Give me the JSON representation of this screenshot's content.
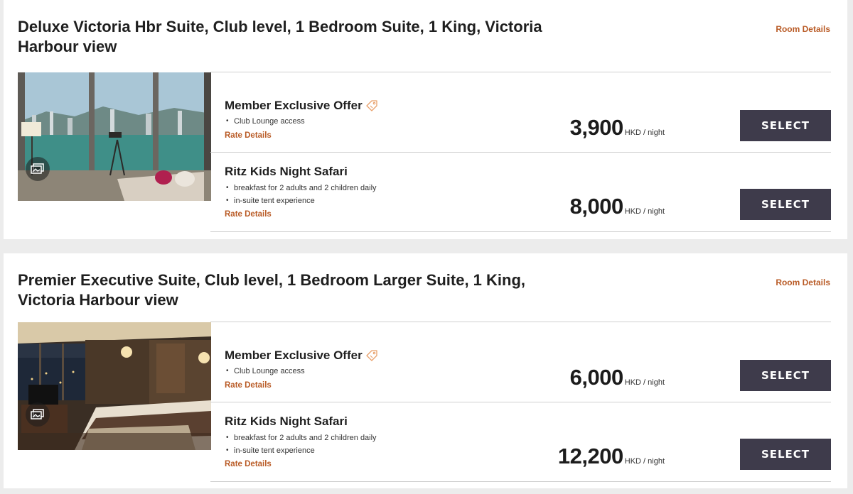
{
  "rooms": [
    {
      "title": "Deluxe Victoria Hbr Suite, Club level, 1 Bedroom Suite, 1 King, Victoria Harbour view",
      "details_label": "Room Details",
      "photo_icon": "gallery-icon",
      "rates": [
        {
          "name": "Member Exclusive Offer",
          "has_tag_icon": true,
          "perks": [
            "Club Lounge access"
          ],
          "details_label": "Rate Details",
          "price": "3,900",
          "unit": "HKD / night",
          "button": "SELECT"
        },
        {
          "name": "Ritz Kids Night Safari",
          "has_tag_icon": false,
          "perks": [
            "breakfast for 2 adults and 2 children daily",
            "in-suite tent experience"
          ],
          "details_label": "Rate Details",
          "price": "8,000",
          "unit": "HKD / night",
          "button": "SELECT"
        }
      ]
    },
    {
      "title": "Premier Executive Suite, Club level, 1 Bedroom Larger Suite, 1 King, Victoria Harbour view",
      "details_label": "Room Details",
      "photo_icon": "gallery-icon",
      "rates": [
        {
          "name": "Member Exclusive Offer",
          "has_tag_icon": true,
          "perks": [
            "Club Lounge access"
          ],
          "details_label": "Rate Details",
          "price": "6,000",
          "unit": "HKD / night",
          "button": "SELECT"
        },
        {
          "name": "Ritz Kids Night Safari",
          "has_tag_icon": false,
          "perks": [
            "breakfast for 2 adults and 2 children daily",
            "in-suite tent experience"
          ],
          "details_label": "Rate Details",
          "price": "12,200",
          "unit": "HKD / night",
          "button": "SELECT"
        }
      ]
    }
  ],
  "colors": {
    "accent": "#b95b26",
    "button_bg": "#3e3b4b",
    "tag_icon": "#e8a06a"
  }
}
